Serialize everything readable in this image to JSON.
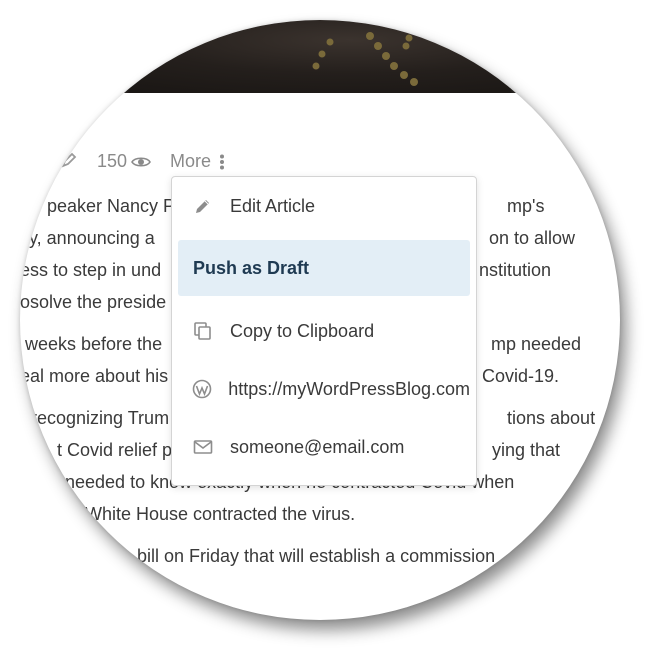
{
  "meta": {
    "view_count": "150",
    "more_label": "More"
  },
  "article": {
    "lines": [
      "peaker Nancy P",
      "mp's",
      "ity, announcing a",
      "on to allow",
      "ess to step in und",
      "nstitution",
      "osolve the preside",
      "weeks before the",
      "mp needed",
      "eal more about his",
      "Covid-19.",
      "recognizing Trum",
      "tions about",
      "t Covid relief pa",
      "ying that",
      "needed to know exactly when he contracted Covid when",
      "White House contracted the virus.",
      "bill on Friday that will establish a commission"
    ]
  },
  "menu": {
    "items": [
      {
        "label": "Edit Article",
        "icon": "pencil-icon"
      },
      {
        "label": "Push as Draft",
        "icon": ""
      },
      {
        "label": "Copy to Clipboard",
        "icon": "copy-icon"
      },
      {
        "label": "https://myWordPressBlog.com",
        "icon": "wordpress-icon"
      },
      {
        "label": "someone@email.com",
        "icon": "mail-icon"
      }
    ]
  },
  "colors": {
    "highlight": "#e3eef6",
    "highlight_text": "#1f3a52",
    "text": "#3a3a3a",
    "muted": "#8a8a8a"
  }
}
